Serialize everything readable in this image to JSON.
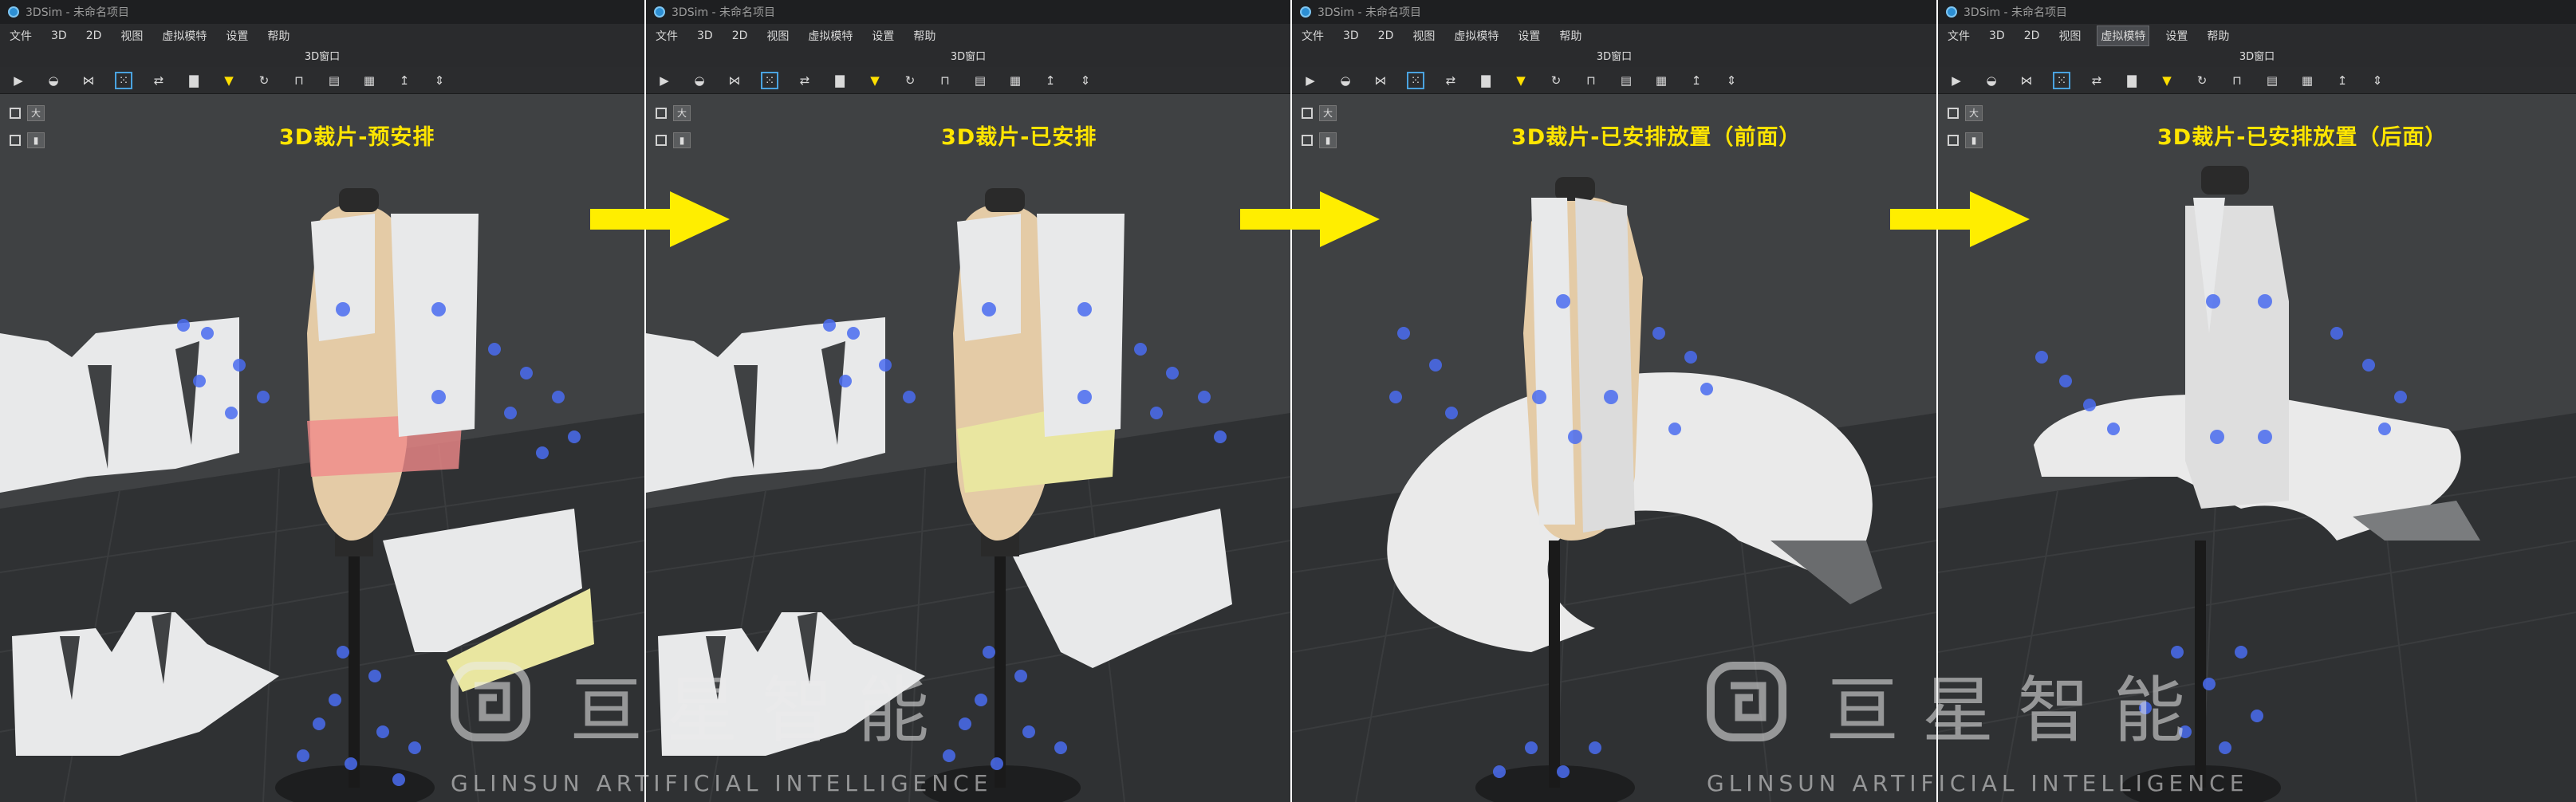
{
  "app": {
    "window_title": "3DSim - 未命名项目",
    "menu": [
      "文件",
      "3D",
      "2D",
      "视图",
      "虚拟模特",
      "设置",
      "帮助"
    ],
    "viewport_title": "3D窗口"
  },
  "toolbar_icons": [
    "play-icon",
    "eye-simulate-icon",
    "hanger-icon",
    "arrange-points-icon",
    "garment-flip-icon",
    "pants-icon",
    "shirt-icon",
    "rotate-icon",
    "tshirt-icon",
    "layer-icon",
    "layer-grid-icon",
    "arrow-up-icon",
    "arrow-updown-icon"
  ],
  "side_toggles": [
    {
      "icon": "fabric-icon"
    },
    {
      "icon": "seam-icon"
    }
  ],
  "panels": [
    {
      "label": "3D裁片-预安排",
      "active_menu": null
    },
    {
      "label": "3D裁片-已安排",
      "active_menu": null
    },
    {
      "label": "3D裁片-已安排放置（前面）",
      "active_menu": null
    },
    {
      "label": "3D裁片-已安排放置（后面）",
      "active_menu": "虚拟模特"
    }
  ],
  "watermark": {
    "chinese": "亘星智能",
    "english": "GLINSUN ARTIFICIAL INTELLIGENCE"
  },
  "colors": {
    "arrow": "#ffee00",
    "label": "#ffe500",
    "arrangement_points": "#4a6cf0",
    "pattern_pieces": "#e8e9ea",
    "highlighted_piece_pink": "#f08a8a",
    "highlighted_piece_yellow": "#e9e6a0"
  }
}
